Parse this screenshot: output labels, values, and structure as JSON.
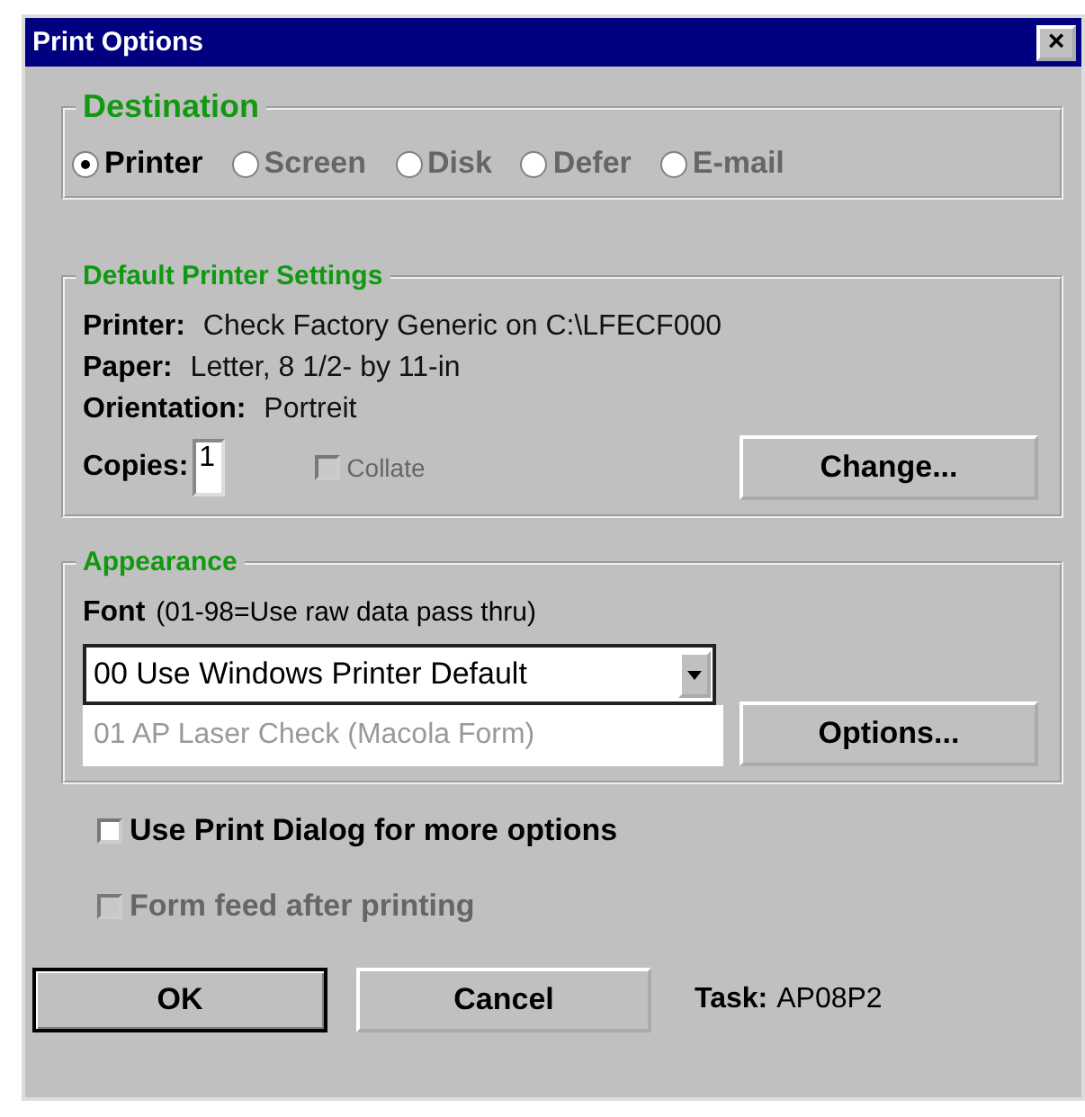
{
  "window": {
    "title": "Print Options",
    "close": "×"
  },
  "destination": {
    "title": "Destination",
    "options": [
      {
        "label": "Printer",
        "selected": true,
        "disabled": false
      },
      {
        "label": "Screen",
        "selected": false,
        "disabled": true
      },
      {
        "label": "Disk",
        "selected": false,
        "disabled": true
      },
      {
        "label": "Defer",
        "selected": false,
        "disabled": true
      },
      {
        "label": "E-mail",
        "selected": false,
        "disabled": true
      }
    ]
  },
  "printer_settings": {
    "title": "Default Printer Settings",
    "rows": [
      {
        "label": "Printer:",
        "value": "Check Factory Generic on C:\\LFECF000"
      },
      {
        "label": "Paper:",
        "value": "Letter, 8 1/2- by 11-in"
      },
      {
        "label": "Orientation:",
        "value": "Portreit"
      }
    ],
    "copies_label": "Copies:",
    "copies": "1",
    "collate": {
      "label": "Collate",
      "checked": false,
      "disabled": true
    },
    "change_button": "Change..."
  },
  "appearance": {
    "title": "Appearance",
    "font_label": "Font",
    "font_hint": "(01-98=Use raw data pass thru)",
    "font_value": "00 Use Windows Printer Default",
    "list_item": "01 AP Laser Check (Macola Form)",
    "options_button": "Options..."
  },
  "checkboxes": [
    {
      "label": "Use Print Dialog for more options",
      "checked": false,
      "disabled": false
    },
    {
      "label": "Form feed after printing",
      "checked": false,
      "disabled": true
    }
  ],
  "buttons": [
    {
      "label": "OK",
      "default": true
    },
    {
      "label": "Cancel",
      "default": false
    }
  ],
  "task": {
    "label": "Task:",
    "value": "AP08P2"
  }
}
